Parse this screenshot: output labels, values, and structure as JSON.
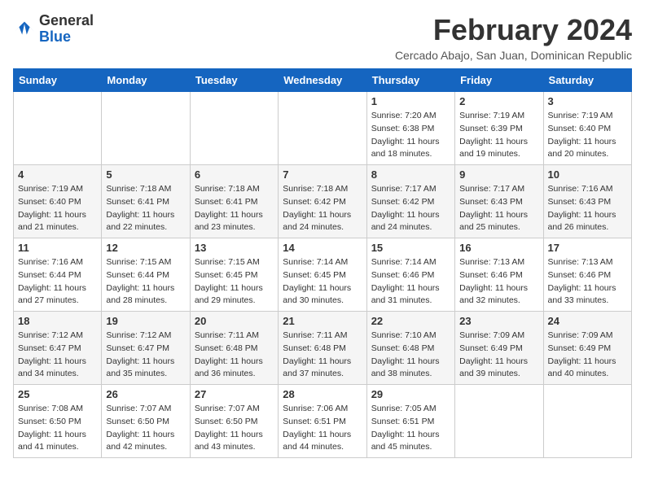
{
  "header": {
    "logo_general": "General",
    "logo_blue": "Blue",
    "month_title": "February 2024",
    "location": "Cercado Abajo, San Juan, Dominican Republic"
  },
  "weekdays": [
    "Sunday",
    "Monday",
    "Tuesday",
    "Wednesday",
    "Thursday",
    "Friday",
    "Saturday"
  ],
  "weeks": [
    [
      {
        "day": "",
        "info": ""
      },
      {
        "day": "",
        "info": ""
      },
      {
        "day": "",
        "info": ""
      },
      {
        "day": "",
        "info": ""
      },
      {
        "day": "1",
        "info": "Sunrise: 7:20 AM\nSunset: 6:38 PM\nDaylight: 11 hours\nand 18 minutes."
      },
      {
        "day": "2",
        "info": "Sunrise: 7:19 AM\nSunset: 6:39 PM\nDaylight: 11 hours\nand 19 minutes."
      },
      {
        "day": "3",
        "info": "Sunrise: 7:19 AM\nSunset: 6:40 PM\nDaylight: 11 hours\nand 20 minutes."
      }
    ],
    [
      {
        "day": "4",
        "info": "Sunrise: 7:19 AM\nSunset: 6:40 PM\nDaylight: 11 hours\nand 21 minutes."
      },
      {
        "day": "5",
        "info": "Sunrise: 7:18 AM\nSunset: 6:41 PM\nDaylight: 11 hours\nand 22 minutes."
      },
      {
        "day": "6",
        "info": "Sunrise: 7:18 AM\nSunset: 6:41 PM\nDaylight: 11 hours\nand 23 minutes."
      },
      {
        "day": "7",
        "info": "Sunrise: 7:18 AM\nSunset: 6:42 PM\nDaylight: 11 hours\nand 24 minutes."
      },
      {
        "day": "8",
        "info": "Sunrise: 7:17 AM\nSunset: 6:42 PM\nDaylight: 11 hours\nand 24 minutes."
      },
      {
        "day": "9",
        "info": "Sunrise: 7:17 AM\nSunset: 6:43 PM\nDaylight: 11 hours\nand 25 minutes."
      },
      {
        "day": "10",
        "info": "Sunrise: 7:16 AM\nSunset: 6:43 PM\nDaylight: 11 hours\nand 26 minutes."
      }
    ],
    [
      {
        "day": "11",
        "info": "Sunrise: 7:16 AM\nSunset: 6:44 PM\nDaylight: 11 hours\nand 27 minutes."
      },
      {
        "day": "12",
        "info": "Sunrise: 7:15 AM\nSunset: 6:44 PM\nDaylight: 11 hours\nand 28 minutes."
      },
      {
        "day": "13",
        "info": "Sunrise: 7:15 AM\nSunset: 6:45 PM\nDaylight: 11 hours\nand 29 minutes."
      },
      {
        "day": "14",
        "info": "Sunrise: 7:14 AM\nSunset: 6:45 PM\nDaylight: 11 hours\nand 30 minutes."
      },
      {
        "day": "15",
        "info": "Sunrise: 7:14 AM\nSunset: 6:46 PM\nDaylight: 11 hours\nand 31 minutes."
      },
      {
        "day": "16",
        "info": "Sunrise: 7:13 AM\nSunset: 6:46 PM\nDaylight: 11 hours\nand 32 minutes."
      },
      {
        "day": "17",
        "info": "Sunrise: 7:13 AM\nSunset: 6:46 PM\nDaylight: 11 hours\nand 33 minutes."
      }
    ],
    [
      {
        "day": "18",
        "info": "Sunrise: 7:12 AM\nSunset: 6:47 PM\nDaylight: 11 hours\nand 34 minutes."
      },
      {
        "day": "19",
        "info": "Sunrise: 7:12 AM\nSunset: 6:47 PM\nDaylight: 11 hours\nand 35 minutes."
      },
      {
        "day": "20",
        "info": "Sunrise: 7:11 AM\nSunset: 6:48 PM\nDaylight: 11 hours\nand 36 minutes."
      },
      {
        "day": "21",
        "info": "Sunrise: 7:11 AM\nSunset: 6:48 PM\nDaylight: 11 hours\nand 37 minutes."
      },
      {
        "day": "22",
        "info": "Sunrise: 7:10 AM\nSunset: 6:48 PM\nDaylight: 11 hours\nand 38 minutes."
      },
      {
        "day": "23",
        "info": "Sunrise: 7:09 AM\nSunset: 6:49 PM\nDaylight: 11 hours\nand 39 minutes."
      },
      {
        "day": "24",
        "info": "Sunrise: 7:09 AM\nSunset: 6:49 PM\nDaylight: 11 hours\nand 40 minutes."
      }
    ],
    [
      {
        "day": "25",
        "info": "Sunrise: 7:08 AM\nSunset: 6:50 PM\nDaylight: 11 hours\nand 41 minutes."
      },
      {
        "day": "26",
        "info": "Sunrise: 7:07 AM\nSunset: 6:50 PM\nDaylight: 11 hours\nand 42 minutes."
      },
      {
        "day": "27",
        "info": "Sunrise: 7:07 AM\nSunset: 6:50 PM\nDaylight: 11 hours\nand 43 minutes."
      },
      {
        "day": "28",
        "info": "Sunrise: 7:06 AM\nSunset: 6:51 PM\nDaylight: 11 hours\nand 44 minutes."
      },
      {
        "day": "29",
        "info": "Sunrise: 7:05 AM\nSunset: 6:51 PM\nDaylight: 11 hours\nand 45 minutes."
      },
      {
        "day": "",
        "info": ""
      },
      {
        "day": "",
        "info": ""
      }
    ]
  ]
}
